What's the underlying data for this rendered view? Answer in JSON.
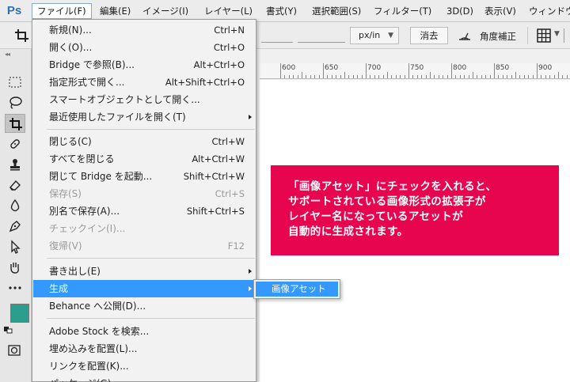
{
  "app": {
    "logo": "Ps"
  },
  "menubar": {
    "items": [
      "ファイル(F)",
      "編集(E)",
      "イメージ(I)",
      "レイヤー(L)",
      "書式(Y)",
      "選択範囲(S)",
      "フィルター(T)",
      "3D(D)",
      "表示(V)",
      "ウィンドウ"
    ],
    "active_index": 0
  },
  "options": {
    "units": "px/in",
    "clear_label": "消去",
    "straighten_label": "角度補正"
  },
  "ruler": {
    "labels": [
      "600",
      "650",
      "700",
      "750",
      "800",
      "850",
      "900"
    ]
  },
  "file_menu": {
    "items": [
      {
        "label": "新規(N)...",
        "shortcut": "Ctrl+N"
      },
      {
        "label": "開く(O)...",
        "shortcut": "Ctrl+O"
      },
      {
        "label": "Bridge で参照(B)...",
        "shortcut": "Alt+Ctrl+O"
      },
      {
        "label": "指定形式で開く...",
        "shortcut": "Alt+Shift+Ctrl+O"
      },
      {
        "label": "スマートオブジェクトとして開く...",
        "shortcut": ""
      },
      {
        "label": "最近使用したファイルを開く(T)",
        "shortcut": "",
        "submenu": true
      },
      {
        "label": "閉じる(C)",
        "shortcut": "Ctrl+W"
      },
      {
        "label": "すべてを閉じる",
        "shortcut": "Alt+Ctrl+W"
      },
      {
        "label": "閉じて Bridge を起動...",
        "shortcut": "Shift+Ctrl+W"
      },
      {
        "label": "保存(S)",
        "shortcut": "Ctrl+S",
        "disabled": true
      },
      {
        "label": "別名で保存(A)...",
        "shortcut": "Shift+Ctrl+S"
      },
      {
        "label": "チェックイン(I)...",
        "shortcut": "",
        "disabled": true
      },
      {
        "label": "復帰(V)",
        "shortcut": "F12",
        "disabled": true
      },
      {
        "label": "書き出し(E)",
        "shortcut": "",
        "submenu": true
      },
      {
        "label": "生成",
        "shortcut": "",
        "submenu": true,
        "highlighted": true
      },
      {
        "label": "Behance へ公開(D)...",
        "shortcut": ""
      },
      {
        "label": "Adobe Stock を検索...",
        "shortcut": ""
      },
      {
        "label": "埋め込みを配置(L)...",
        "shortcut": ""
      },
      {
        "label": "リンクを配置(K)...",
        "shortcut": ""
      },
      {
        "label": "パッケージ(G)...",
        "shortcut": ""
      }
    ]
  },
  "submenu": {
    "label": "画像アセット"
  },
  "callout": {
    "lines": [
      "「画像アセット」にチェックを入れると、",
      "サポートされている画像形式の拡張子が",
      "レイヤー名になっているアセットが",
      "自動的に生成されます。"
    ]
  },
  "colors": {
    "foreground": "#2b9e8e",
    "callout_bg": "#e8054f",
    "menu_highlight": "#3399ff",
    "logo": "#2f6fb8"
  }
}
